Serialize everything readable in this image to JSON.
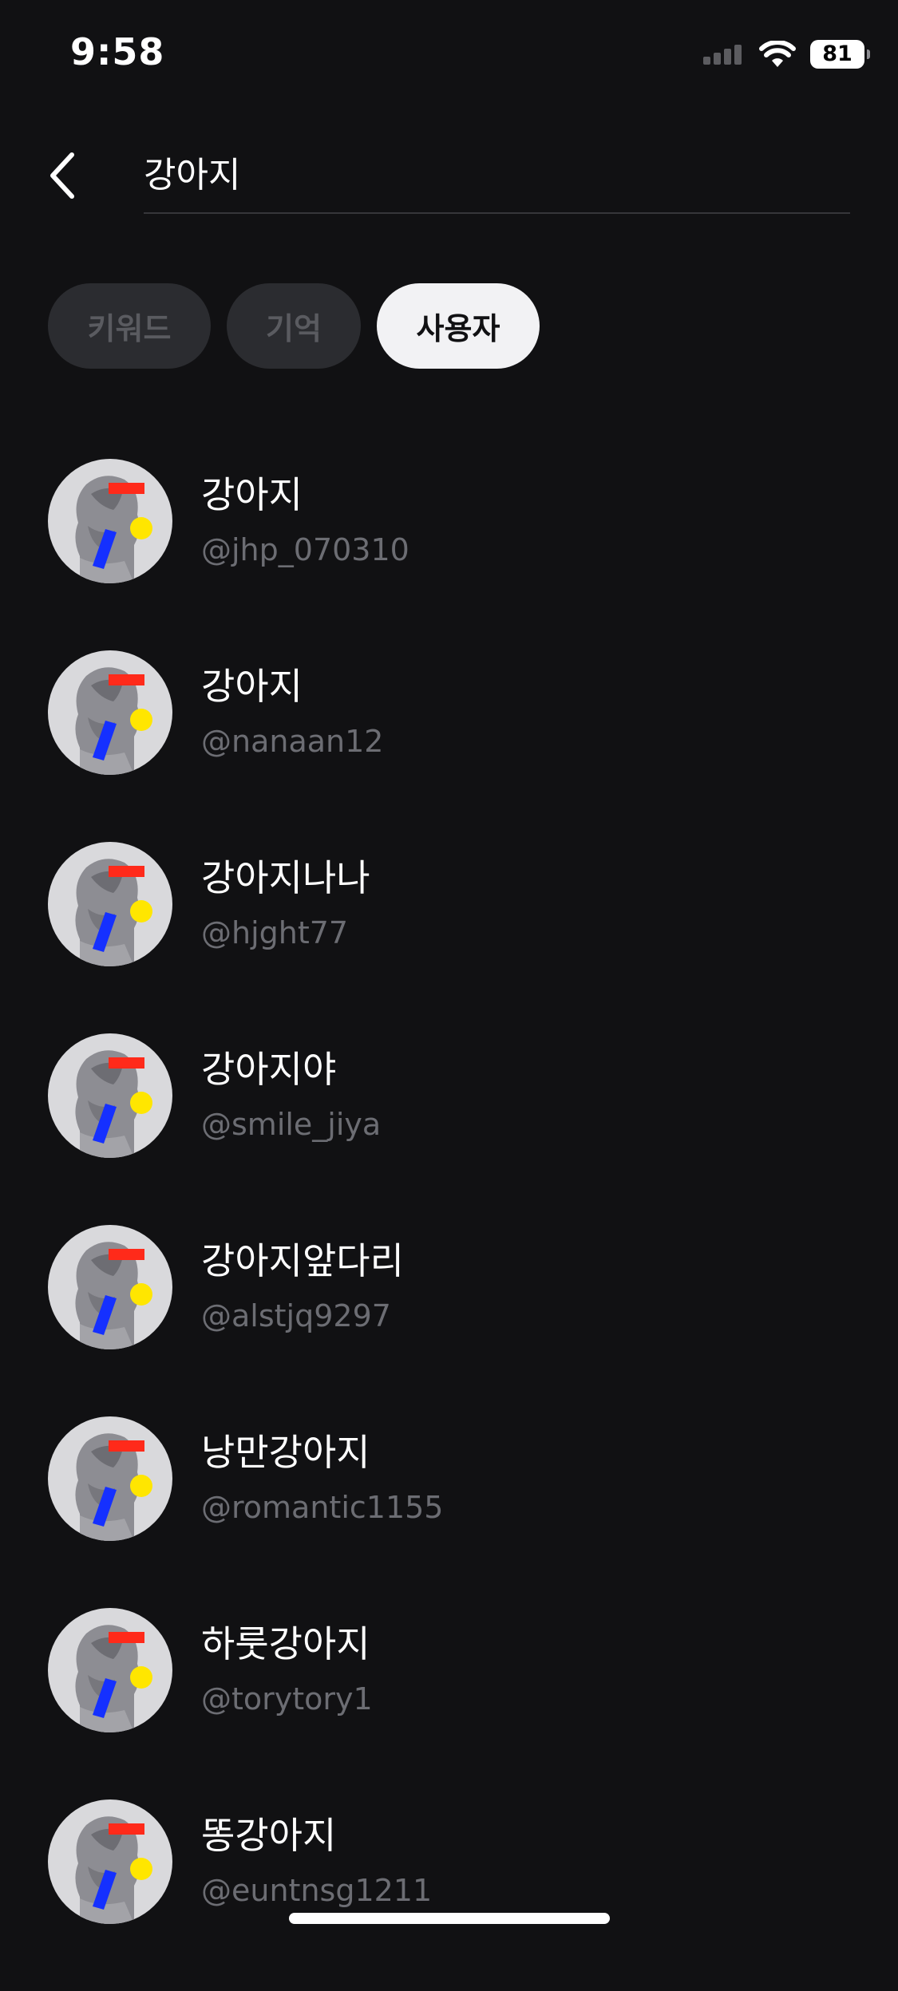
{
  "status_bar": {
    "time": "9:58",
    "battery": "81",
    "icons": [
      "signal-icon",
      "wifi-icon",
      "battery-icon"
    ]
  },
  "search": {
    "value": "강아지",
    "back_icon": "chevron-left-icon"
  },
  "tabs": [
    {
      "label": "키워드",
      "active": false
    },
    {
      "label": "기억",
      "active": false
    },
    {
      "label": "사용자",
      "active": true
    }
  ],
  "users": [
    {
      "name": "강아지",
      "handle": "@jhp_070310"
    },
    {
      "name": "강아지",
      "handle": "@nanaan12"
    },
    {
      "name": "강아지나나",
      "handle": "@hjght77"
    },
    {
      "name": "강아지야",
      "handle": "@smile_jiya"
    },
    {
      "name": "강아지앞다리",
      "handle": "@alstjq9297"
    },
    {
      "name": "낭만강아지",
      "handle": "@romantic1155"
    },
    {
      "name": "하룻강아지",
      "handle": "@torytory1"
    },
    {
      "name": "똥강아지",
      "handle": "@euntnsg1211"
    }
  ],
  "colors": {
    "background": "#111113",
    "active_tab": "#f2f2f4",
    "inactive_tab": "#2b2c30",
    "handle_text": "#6c6d73",
    "avatar_red": "#ff2a1a",
    "avatar_yellow": "#ffe600",
    "avatar_blue": "#1530ff"
  }
}
